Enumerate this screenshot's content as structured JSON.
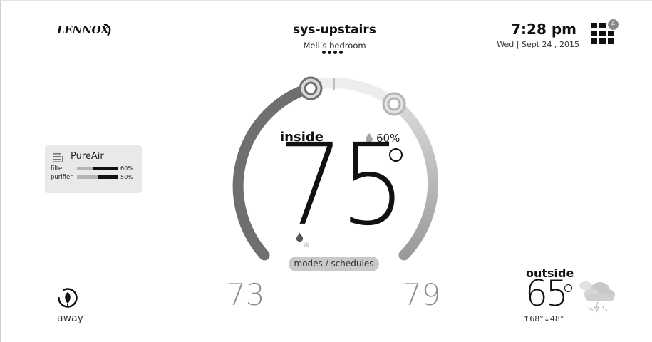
{
  "brand": {
    "logo_text": "LENNOX"
  },
  "header": {
    "system_name": "sys-upstairs",
    "zone_name": "Meli’s bedroom",
    "time": "7:28 pm",
    "date": "Wed | Sept 24 , 2015",
    "notification_count": "4",
    "page_dots_count": 4
  },
  "dial": {
    "inside_label": "inside",
    "indoor_temp": "75",
    "humidity": "60%",
    "heat_setpoint": "73",
    "cool_setpoint": "79",
    "modes_button_label": "modes / schedules",
    "snow_glyph": "❄"
  },
  "pureair": {
    "title": "PureAir",
    "rows": [
      {
        "label": "filter",
        "percent": "60%",
        "level": 0.6
      },
      {
        "label": "purifier",
        "percent": "50%",
        "level": 0.5
      }
    ]
  },
  "away": {
    "label": "away"
  },
  "outside": {
    "label": "outside",
    "temp": "65",
    "high_low": "↑68°↓48°"
  },
  "colors": {
    "text_primary": "#111111",
    "arc_heat": "#6f6f6f",
    "arc_cool": "#b5b5b5",
    "panel_bg": "#e9e9e9",
    "button_bg": "#c9c9c9"
  },
  "icons": [
    "logo-swoosh-icon",
    "apps-grid-icon",
    "humidity-drop-icon",
    "flame-icon",
    "snowflake-icon",
    "filter-list-icon",
    "away-leaf-icon",
    "weather-storm-cloud-icon"
  ]
}
